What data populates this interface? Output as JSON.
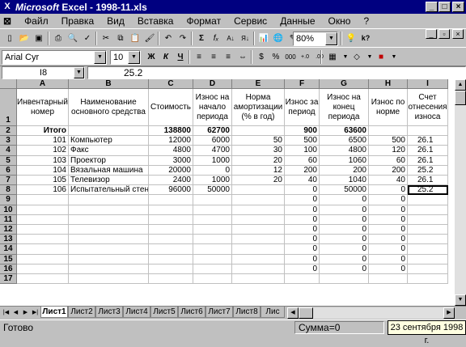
{
  "window": {
    "app_name": "Microsoft",
    "title_rest": " Excel - 1998-11.xls",
    "app_icon": "excel-x-icon"
  },
  "menu": [
    "Файл",
    "Правка",
    "Вид",
    "Вставка",
    "Формат",
    "Сервис",
    "Данные",
    "Окно",
    "?"
  ],
  "toolbar": {
    "zoom": "80%",
    "font": "Arial Cyr",
    "size": "10",
    "bold": "Ж",
    "italic": "К",
    "underline": "Ч",
    "currency": "%",
    "thousands": "000",
    "sigma": "Σ",
    "fx": "fₓ"
  },
  "formula_bar": {
    "cell_ref": "I8",
    "value": "25.2"
  },
  "columns": [
    "A",
    "B",
    "C",
    "D",
    "E",
    "F",
    "G",
    "H",
    "I"
  ],
  "header_row": {
    "A": "Инвентарный номер",
    "B": "Наименование основного средства",
    "C": "Стоимость",
    "D": "Износ на начало периода",
    "E": "Норма амортизации (% в год)",
    "F": "Износ за период",
    "G": "Износ на конец периода",
    "H": "Износ по норме",
    "I": "Счет отнесения износа"
  },
  "rows": [
    {
      "n": "2",
      "A": "Итого",
      "B": "",
      "C": "138800",
      "D": "62700",
      "E": "",
      "F": "900",
      "G": "63600",
      "H": "",
      "I": ""
    },
    {
      "n": "3",
      "A": "101",
      "B": "Компьютер",
      "C": "12000",
      "D": "6000",
      "E": "50",
      "F": "500",
      "G": "6500",
      "H": "500",
      "I": "26.1"
    },
    {
      "n": "4",
      "A": "102",
      "B": "Факс",
      "C": "4800",
      "D": "4700",
      "E": "30",
      "F": "100",
      "G": "4800",
      "H": "120",
      "I": "26.1"
    },
    {
      "n": "5",
      "A": "103",
      "B": "Проектор",
      "C": "3000",
      "D": "1000",
      "E": "20",
      "F": "60",
      "G": "1060",
      "H": "60",
      "I": "26.1"
    },
    {
      "n": "6",
      "A": "104",
      "B": "Вязальная машина",
      "C": "20000",
      "D": "0",
      "E": "12",
      "F": "200",
      "G": "200",
      "H": "200",
      "I": "25.2"
    },
    {
      "n": "7",
      "A": "105",
      "B": "Телевизор",
      "C": "2400",
      "D": "1000",
      "E": "20",
      "F": "40",
      "G": "1040",
      "H": "40",
      "I": "26.1"
    },
    {
      "n": "8",
      "A": "106",
      "B": "Испытательный стенд",
      "C": "96000",
      "D": "50000",
      "E": "",
      "F": "0",
      "G": "50000",
      "H": "0",
      "I": "25.2"
    },
    {
      "n": "9",
      "A": "",
      "B": "",
      "C": "",
      "D": "",
      "E": "",
      "F": "0",
      "G": "0",
      "H": "0",
      "I": ""
    },
    {
      "n": "10",
      "A": "",
      "B": "",
      "C": "",
      "D": "",
      "E": "",
      "F": "0",
      "G": "0",
      "H": "0",
      "I": ""
    },
    {
      "n": "11",
      "A": "",
      "B": "",
      "C": "",
      "D": "",
      "E": "",
      "F": "0",
      "G": "0",
      "H": "0",
      "I": ""
    },
    {
      "n": "12",
      "A": "",
      "B": "",
      "C": "",
      "D": "",
      "E": "",
      "F": "0",
      "G": "0",
      "H": "0",
      "I": ""
    },
    {
      "n": "13",
      "A": "",
      "B": "",
      "C": "",
      "D": "",
      "E": "",
      "F": "0",
      "G": "0",
      "H": "0",
      "I": ""
    },
    {
      "n": "14",
      "A": "",
      "B": "",
      "C": "",
      "D": "",
      "E": "",
      "F": "0",
      "G": "0",
      "H": "0",
      "I": ""
    },
    {
      "n": "15",
      "A": "",
      "B": "",
      "C": "",
      "D": "",
      "E": "",
      "F": "0",
      "G": "0",
      "H": "0",
      "I": ""
    },
    {
      "n": "16",
      "A": "",
      "B": "",
      "C": "",
      "D": "",
      "E": "",
      "F": "0",
      "G": "0",
      "H": "0",
      "I": ""
    },
    {
      "n": "17",
      "A": "",
      "B": "",
      "C": "",
      "D": "",
      "E": "",
      "F": "",
      "G": "",
      "H": "",
      "I": ""
    }
  ],
  "sheet_tabs": [
    "Лист1",
    "Лист2",
    "Лист3",
    "Лист4",
    "Лист5",
    "Лист6",
    "Лист7",
    "Лист8",
    "Лис"
  ],
  "active_tab": "Лист1",
  "status": {
    "ready": "Готово",
    "sum": "Сумма=0",
    "date": "23 сентября 1998 г."
  }
}
